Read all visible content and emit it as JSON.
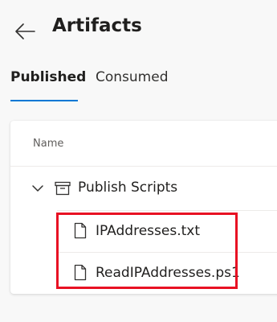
{
  "header": {
    "title": "Artifacts",
    "back_icon": "arrow-left-icon"
  },
  "tabs": [
    {
      "label": "Published",
      "selected": true
    },
    {
      "label": "Consumed",
      "selected": false
    }
  ],
  "colors": {
    "accent": "#0078d4",
    "highlight": "#e81123"
  },
  "table": {
    "column_header": "Name",
    "folder": {
      "label": "Publish Scripts",
      "expanded": true,
      "chevron_icon": "chevron-down-icon",
      "icon": "artifact-archive-icon"
    },
    "files": [
      {
        "label": "IPAddresses.txt",
        "icon": "file-icon"
      },
      {
        "label": "ReadIPAddresses.ps1",
        "icon": "file-icon"
      }
    ]
  }
}
